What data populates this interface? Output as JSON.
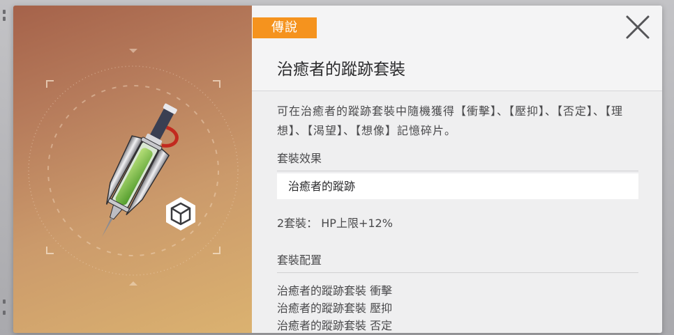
{
  "item": {
    "rarity": "傳說",
    "title": "治癒者的蹤跡套裝",
    "description": "可在治癒者的蹤跡套裝中隨機獲得【衝擊】、【壓抑】、【否定】、【理想】、【渴望】、【想像】記憶碎片。"
  },
  "set_effect": {
    "heading": "套裝效果",
    "set_name": "治癒者的蹤跡",
    "bonus": "2套裝： HP上限+12%"
  },
  "set_config": {
    "heading": "套裝配置",
    "items": [
      "治癒者的蹤跡套裝 衝擊",
      "治癒者的蹤跡套裝 壓抑",
      "治癒者的蹤跡套裝 否定"
    ]
  },
  "icons": {
    "close": "close-icon",
    "item_art": "syringe-item-icon",
    "type": "cube-type-icon"
  },
  "colors": {
    "rarity_badge": "#f5931e",
    "panel_background": "#efeff0",
    "art_gradient_top": "#a5624a",
    "art_gradient_bottom": "#dbb270"
  }
}
